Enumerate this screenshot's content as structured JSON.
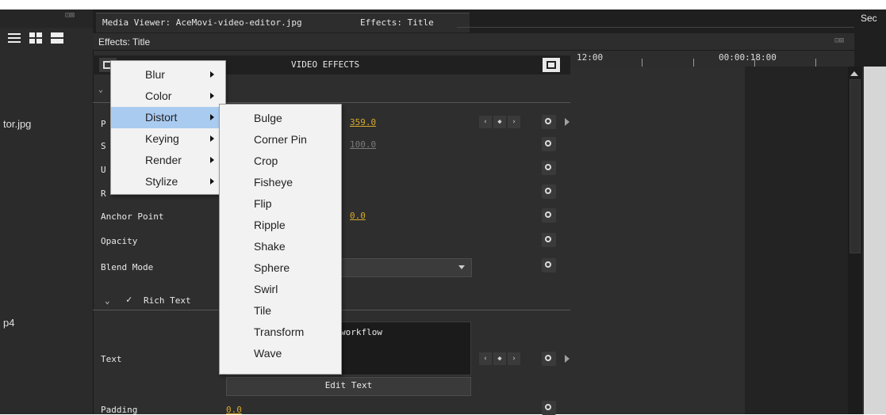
{
  "tabs": {
    "media_viewer": "Media Viewer: AceMovi-video-editor.jpg",
    "effects": "Effects: Title"
  },
  "subheader": {
    "title": "Effects: Title"
  },
  "left": {
    "items": [
      {
        "label": "tor.jpg"
      },
      {
        "label": "p4"
      }
    ]
  },
  "effects_panel": {
    "header": "VIDEO EFFECTS",
    "rows": {
      "position": {
        "label": "P",
        "value": "359.0"
      },
      "scale": {
        "label": "S",
        "value": "100.0"
      },
      "uniform": {
        "label": "U"
      },
      "rotation": {
        "label": "R"
      },
      "anchor_point": {
        "label": "Anchor Point",
        "value": "0.0"
      },
      "opacity": {
        "label": "Opacity"
      },
      "blend_mode": {
        "label": "Blend Mode"
      },
      "rich_text": {
        "label": "Rich Text",
        "check": "✓"
      },
      "text": {
        "label": "Text",
        "content": "workflow"
      },
      "edit_text": {
        "label": "Edit Text"
      },
      "padding": {
        "label": "Padding",
        "value": "0.0"
      }
    }
  },
  "timeline": {
    "time1": "12:00",
    "time2": "00:00:18:00",
    "right_label": "Sec"
  },
  "menu_main": {
    "items": [
      {
        "label": "Blur"
      },
      {
        "label": "Color"
      },
      {
        "label": "Distort"
      },
      {
        "label": "Keying"
      },
      {
        "label": "Render"
      },
      {
        "label": "Stylize"
      }
    ]
  },
  "menu_distort": {
    "items": [
      {
        "label": "Bulge"
      },
      {
        "label": "Corner Pin"
      },
      {
        "label": "Crop"
      },
      {
        "label": "Fisheye"
      },
      {
        "label": "Flip"
      },
      {
        "label": "Ripple"
      },
      {
        "label": "Shake"
      },
      {
        "label": "Sphere"
      },
      {
        "label": "Swirl"
      },
      {
        "label": "Tile"
      },
      {
        "label": "Transform"
      },
      {
        "label": "Wave"
      }
    ]
  },
  "colors": {
    "highlight": "#aacbf0",
    "value": "#d6a92a",
    "panel": "#2e2e2e"
  }
}
